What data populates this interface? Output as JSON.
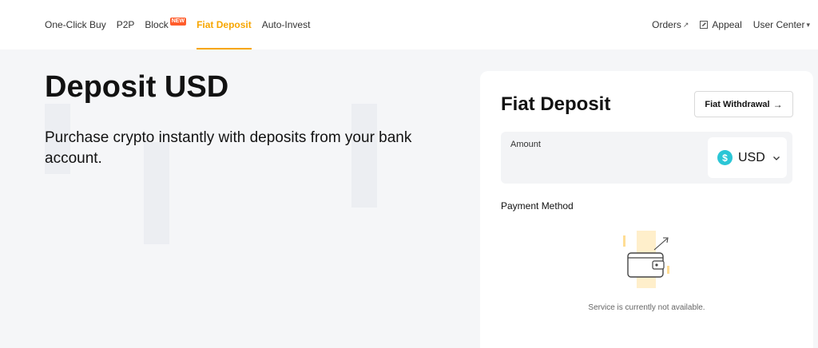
{
  "nav": {
    "left": [
      {
        "label": "One-Click Buy",
        "active": false
      },
      {
        "label": "P2P",
        "active": false
      },
      {
        "label": "Block",
        "active": false,
        "badge": "NEW"
      },
      {
        "label": "Fiat Deposit",
        "active": true
      },
      {
        "label": "Auto-Invest",
        "active": false
      }
    ],
    "orders_label": "Orders",
    "orders_glyph": "↗",
    "appeal_label": "Appeal",
    "user_center_label": "User Center",
    "user_center_glyph": "▾"
  },
  "hero": {
    "title": "Deposit USD",
    "subtitle": "Purchase crypto instantly with deposits from your bank account."
  },
  "card": {
    "title": "Fiat Deposit",
    "withdraw_label": "Fiat Withdrawal",
    "withdraw_arrow": "→",
    "amount_label": "Amount",
    "amount_value": "",
    "currency": "USD",
    "currency_symbol": "$",
    "payment_method_label": "Payment Method",
    "empty_message": "Service is currently not available."
  },
  "colors": {
    "accent": "#f7a600",
    "badge": "#ff5c2b",
    "usd_icon": "#2bc6d6"
  },
  "icons": [
    "edit-icon",
    "arrow-up-right-icon",
    "caret-down-icon",
    "dollar-icon",
    "chevron-down-icon",
    "wallet-illustration"
  ]
}
